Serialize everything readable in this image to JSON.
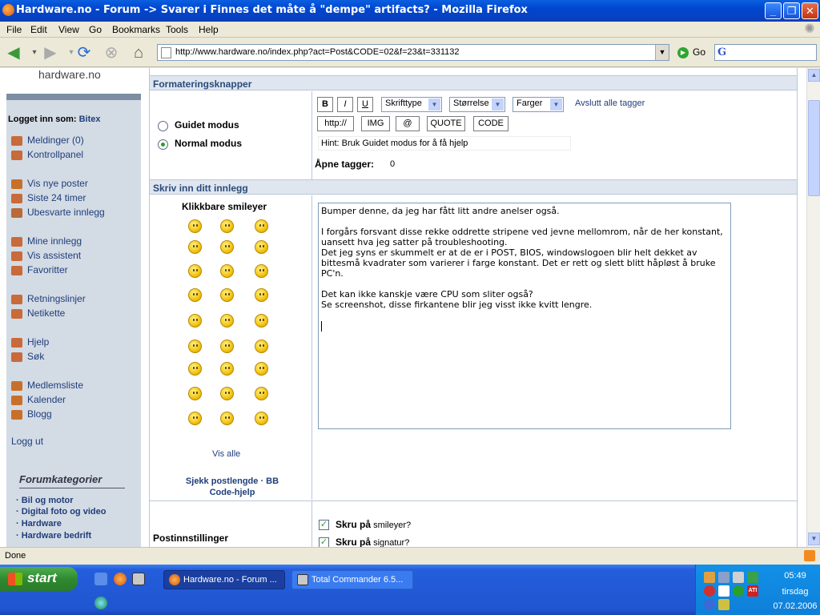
{
  "window": {
    "title": "Hardware.no - Forum -> Svarer i Finnes det måte å \"dempe\" artifacts? - Mozilla Firefox"
  },
  "menu": [
    "File",
    "Edit",
    "View",
    "Go",
    "Bookmarks",
    "Tools",
    "Help"
  ],
  "nav": {
    "url": "http://www.hardware.no/index.php?act=Post&CODE=02&f=23&t=331132",
    "go_label": "Go"
  },
  "sidebar": {
    "logo": "hardware.no",
    "logged_in_label": "Logget inn som:",
    "logged_in_user": "Bitex",
    "links": [
      {
        "label": "Meldinger (0)",
        "icon": "mail-icon"
      },
      {
        "label": "Kontrollpanel",
        "icon": "controlpanel-icon"
      },
      {
        "label": "Vis nye poster",
        "icon": "newposts-icon"
      },
      {
        "label": "Siste 24 timer",
        "icon": "clock-icon"
      },
      {
        "label": "Ubesvarte innlegg",
        "icon": "unanswered-icon"
      },
      {
        "label": "Mine innlegg",
        "icon": "myposts-icon"
      },
      {
        "label": "Vis assistent",
        "icon": "assistant-icon"
      },
      {
        "label": "Favoritter",
        "icon": "favorites-icon"
      },
      {
        "label": "Retningslinjer",
        "icon": "guidelines-icon"
      },
      {
        "label": "Netikette",
        "icon": "netiquette-icon"
      },
      {
        "label": "Hjelp",
        "icon": "help-icon"
      },
      {
        "label": "Søk",
        "icon": "search-icon"
      },
      {
        "label": "Medlemsliste",
        "icon": "members-icon"
      },
      {
        "label": "Kalender",
        "icon": "calendar-icon"
      },
      {
        "label": "Blogg",
        "icon": "blog-icon"
      }
    ],
    "logout": "Logg ut",
    "categories_title": "Forumkategorier",
    "categories": [
      "· Bil og motor",
      "· Digital foto og video",
      "· Hardware",
      "· Hardware bedrift"
    ]
  },
  "form": {
    "formatting_header": "Formateringsknapper",
    "mode_guided": "Guidet modus",
    "mode_normal": "Normal modus",
    "btn_bold": "B",
    "btn_italic": "I",
    "btn_underline": "U",
    "select_font": "Skrifttype",
    "select_size": "Størrelse",
    "select_color": "Farger",
    "close_all_tags": "Avslutt alle tagger",
    "btn_http": "http://",
    "btn_img": "IMG",
    "btn_email": "@",
    "btn_quote": "QUOTE",
    "btn_code": "CODE",
    "hint": "Hint: Bruk Guidet modus for å få hjelp",
    "open_tags_label": "Åpne tagger:",
    "open_tags_value": "0",
    "write_header": "Skriv inn ditt innlegg",
    "smileys_header": "Klikkbare smileyer",
    "show_all": "Vis alle",
    "help_links": "Sjekk postlengde · BB Code-hjelp",
    "post_text": "Bumper denne, da jeg har fått litt andre anelser også.\n\nI forgårs forsvant disse rekke oddrette stripene ved jevne mellomrom, når de her konstant, uansett hva jeg satter på troubleshooting.\nDet jeg syns er skummelt er at de er i POST, BIOS, windowslogoen blir helt dekket av bittesmå kvadrater som varierer i farge konstant. Det er rett og slett blitt håpløst å bruke PC'n.\n\nDet kan ikke kanskje være CPU som sliter også?\nSe screenshot, disse firkantene blir jeg visst ikke kvitt lengre.\n\n",
    "options_label": "Postinnstillinger",
    "opt_smileys_bold": "Skru på",
    "opt_smileys": "smileyer?",
    "opt_signature_bold": "Skru på",
    "opt_signature": "signatur?"
  },
  "status": {
    "text": "Done"
  },
  "taskbar": {
    "start": "start",
    "tasks": [
      {
        "label": "Hardware.no - Forum ...",
        "active": true
      },
      {
        "label": "Total Commander 6.5...",
        "active": false
      }
    ],
    "clock_time": "05:49",
    "clock_day": "tirsdag",
    "clock_date": "07.02.2006"
  }
}
